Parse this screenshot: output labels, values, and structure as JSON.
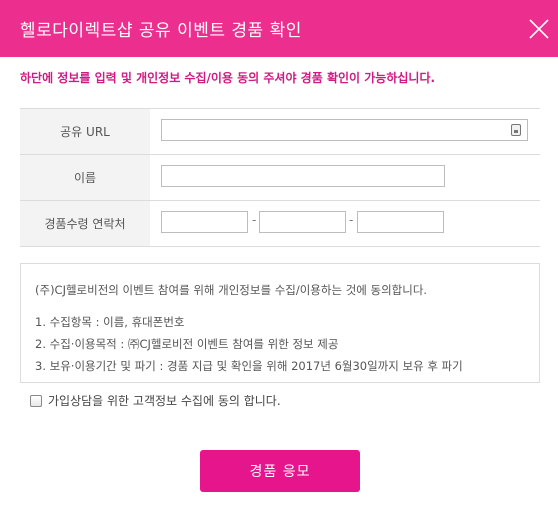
{
  "title": "헬로다이렉트샵 공유 이벤트 경품 확인",
  "notice": "하단에 정보를 입력 및 개인정보 수집/이용 동의 주셔야 경품 확인이 가능하십니다.",
  "form": {
    "url_label": "공유 URL",
    "url_value": "",
    "name_label": "이름",
    "name_value": "",
    "phone_label": "경품수령 연락처",
    "phone_part1": "",
    "phone_part2": "",
    "phone_part3": "",
    "phone_separator": "-"
  },
  "consent": {
    "intro": "(주)CJ헬로비전의 이벤트 참여를 위해 개인정보를 수집/이용하는 것에 동의합니다.",
    "item1": "1. 수집항목 : 이름, 휴대폰번호",
    "item2": "2. 수집·이용목적 : ㈜CJ헬로비전 이벤트 참여를 위한 정보 제공",
    "item3": "3. 보유·이용기간 및 파기 : 경품 지급 및 확인을 위해 2017년 6월30일까지 보유 후 파기"
  },
  "agree_label": "가입상담을 위한 고객정보 수집에 동의 합니다.",
  "submit_label": "경품 응모",
  "colors": {
    "brand": "#ec2f8e",
    "notice": "#cf1b83",
    "button": "#e6158b"
  },
  "icons": {
    "close": "close-icon",
    "url": "clipboard-icon",
    "checkbox": "checkbox-unchecked"
  }
}
